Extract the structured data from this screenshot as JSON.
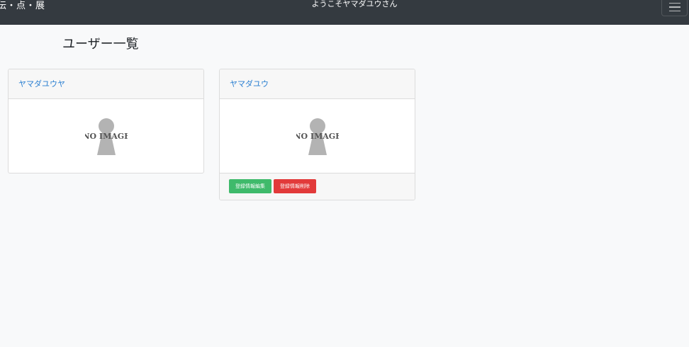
{
  "navbar": {
    "brand": "伝・点・展",
    "welcome": "ようこそヤマダユウさん",
    "toggle_icon": "hamburger-menu-icon"
  },
  "page": {
    "title": "ユーザー一覧"
  },
  "users": [
    {
      "name": "ヤマダユウヤ",
      "image_text": "NO IMAGE"
    },
    {
      "name": "ヤマダユウ",
      "image_text": "NO IMAGE",
      "edit_label": "登録情報編集",
      "delete_label": "登録情報削除"
    }
  ],
  "colors": {
    "navbar_bg": "#343a40",
    "page_bg": "#f8f9fa",
    "link": "#2a7fd1",
    "success": "#3fba6b",
    "danger": "#e23a3a",
    "placeholder_gray": "#b3b3b3",
    "placeholder_text": "#555555"
  }
}
